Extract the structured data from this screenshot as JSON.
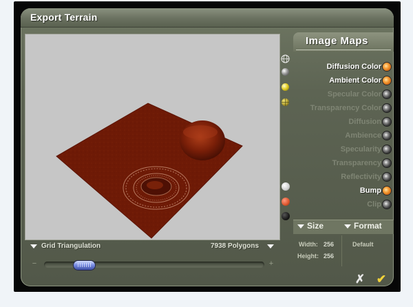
{
  "window": {
    "title": "Export Terrain"
  },
  "image_maps": {
    "header": "Image Maps",
    "items": [
      {
        "label": "Diffusion Color",
        "enabled": true
      },
      {
        "label": "Ambient Color",
        "enabled": true
      },
      {
        "label": "Specular Color",
        "enabled": false
      },
      {
        "label": "Transparency Color",
        "enabled": false
      },
      {
        "label": "Diffusion",
        "enabled": false
      },
      {
        "label": "Ambience",
        "enabled": false
      },
      {
        "label": "Specularity",
        "enabled": false
      },
      {
        "label": "Transparency",
        "enabled": false
      },
      {
        "label": "Reflectivity",
        "enabled": false
      },
      {
        "label": "Bump",
        "enabled": true
      },
      {
        "label": "Clip",
        "enabled": false
      }
    ]
  },
  "size_panel": {
    "label": "Size",
    "width_label": "Width:",
    "width_value": "256",
    "height_label": "Height:",
    "height_value": "256"
  },
  "format_panel": {
    "label": "Format",
    "value": "Default"
  },
  "preview": {
    "mode": "Grid Triangulation",
    "polygons": "7938 Polygons",
    "terrain_color": "#6e1a06"
  },
  "slider": {
    "position": 0.15
  },
  "icons": {
    "view_buttons": [
      "globe-wireframe-icon",
      "gray-sphere-icon",
      "yellow-sphere-icon",
      "grid-sphere-icon"
    ],
    "color_buttons": [
      "white-swatch-icon",
      "orange-swatch-icon",
      "black-swatch-icon"
    ],
    "cancel": "cancel-x-icon",
    "ok": "ok-checkmark-icon"
  },
  "colors": {
    "panel": "#5d6453",
    "accent_on": "#f7a23c",
    "thumb": "#7b8fe6"
  }
}
